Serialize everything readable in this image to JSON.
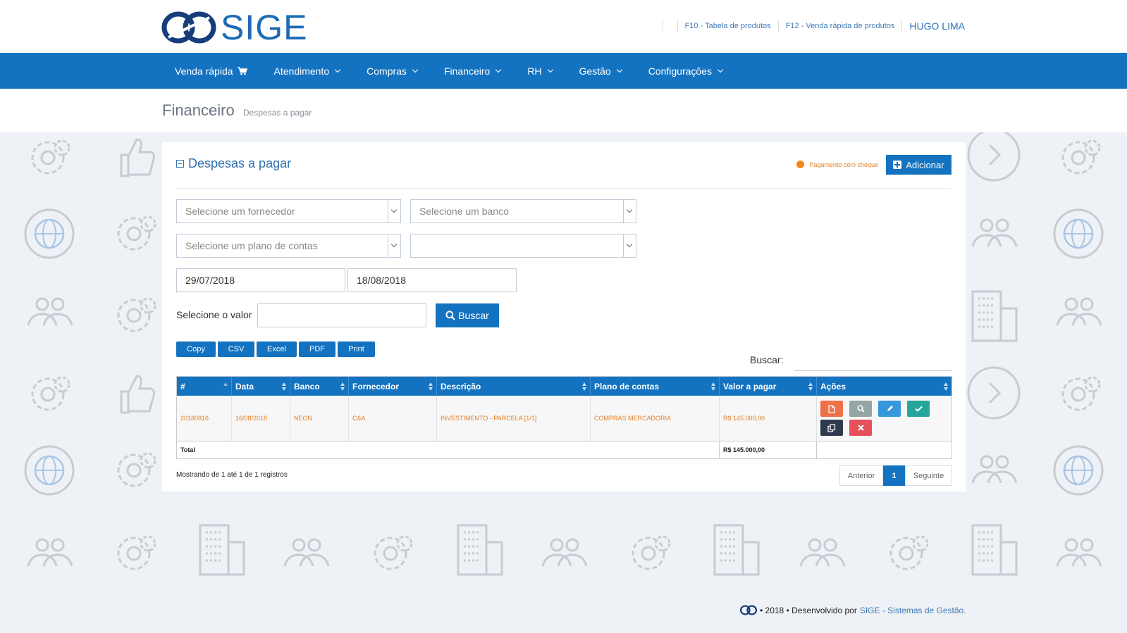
{
  "brand": {
    "name": "SIGE",
    "color": "#1473c0"
  },
  "toplinks": {
    "f10": "F10 - Tabela de produtos",
    "f12": "F12 - Venda rápida de produtos",
    "user": "HUGO LIMA"
  },
  "nav": {
    "items": [
      {
        "label": "Venda rápida",
        "icon": "cart-icon"
      },
      {
        "label": "Atendimento",
        "icon": "chevron-down-icon"
      },
      {
        "label": "Compras",
        "icon": "chevron-down-icon"
      },
      {
        "label": "Financeiro",
        "icon": "chevron-down-icon"
      },
      {
        "label": "RH",
        "icon": "chevron-down-icon"
      },
      {
        "label": "Gestão",
        "icon": "chevron-down-icon"
      },
      {
        "label": "Configurações",
        "icon": "chevron-down-icon"
      }
    ]
  },
  "breadcrumb": {
    "title": "Financeiro",
    "subtitle": "Despesas a pagar"
  },
  "panel": {
    "title": "Despesas a pagar",
    "legend": "Pagamento com cheque",
    "add_label": "Adicionar"
  },
  "filters": {
    "fornecedor_placeholder": "Selecione um fornecedor",
    "banco_placeholder": "Selecione um banco",
    "plano_placeholder": "Selecione um plano de contas",
    "extra_select": "",
    "date_from": "29/07/2018",
    "date_to": "18/08/2018",
    "valor_label": "Selecione o valor",
    "valor_value": "",
    "search_label": "Buscar"
  },
  "export": {
    "copy": "Copy",
    "csv": "CSV",
    "excel": "Excel",
    "pdf": "PDF",
    "print": "Print"
  },
  "table": {
    "search_label": "Buscar:",
    "headers": [
      "#",
      "Data",
      "Banco",
      "Fornecedor",
      "Descrição",
      "Plano de contas",
      "Valor a pagar",
      "Ações"
    ],
    "rows": [
      {
        "id": "20180816",
        "data": "16/08/2018",
        "banco": "NEON",
        "fornecedor": "C&A",
        "descricao": "INVESTIMENTO - PARCELA [1/1]",
        "plano": "COMPRAS MERCADORIA",
        "valor": "R$ 145.000,00"
      }
    ],
    "total_label": "Total",
    "total_value": "R$ 145.000,00",
    "info": "Mostrando de 1 até 1 de 1 registros"
  },
  "pagination": {
    "prev": "Anterior",
    "current": "1",
    "next": "Seguinte"
  },
  "footer": {
    "text": "• 2018 • Desenvolvido por",
    "link": "SIGE - Sistemas de Gestão."
  }
}
